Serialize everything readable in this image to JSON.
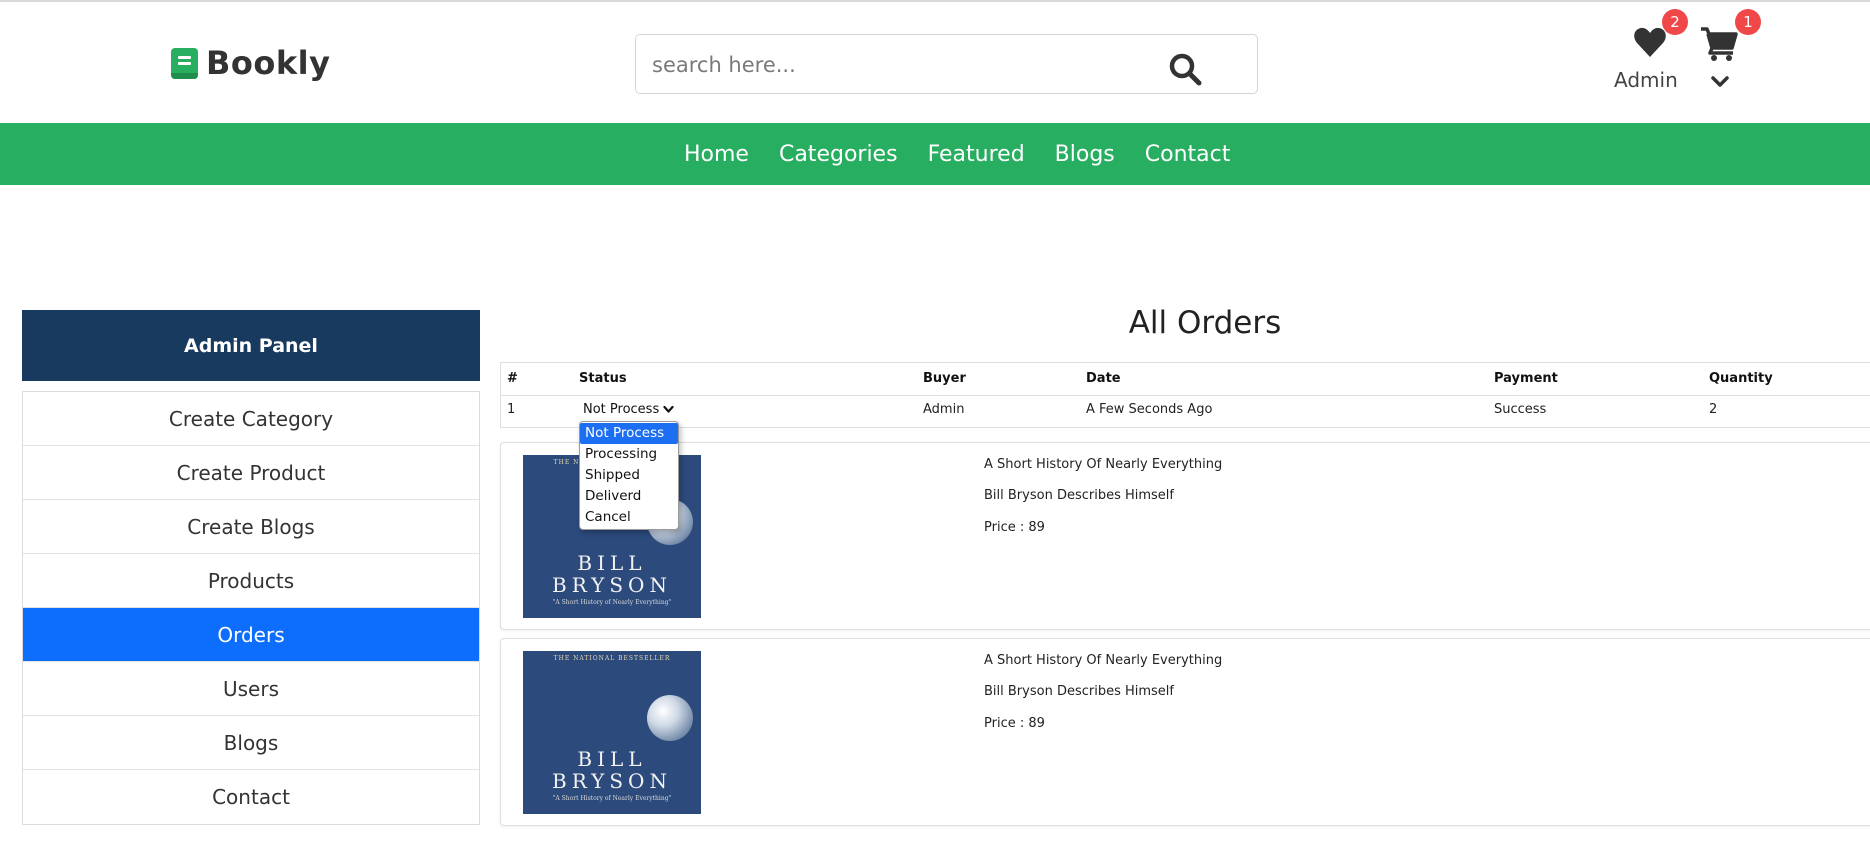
{
  "brand": {
    "name": "Bookly"
  },
  "search": {
    "placeholder": "search here..."
  },
  "header": {
    "wishlist_count": "2",
    "cart_count": "1",
    "user_label": "Admin"
  },
  "nav": {
    "items": [
      {
        "label": "Home"
      },
      {
        "label": "Categories"
      },
      {
        "label": "Featured"
      },
      {
        "label": "Blogs"
      },
      {
        "label": "Contact"
      }
    ]
  },
  "sidebar": {
    "title": "Admin Panel",
    "items": [
      {
        "label": "Create Category"
      },
      {
        "label": "Create Product"
      },
      {
        "label": "Create Blogs"
      },
      {
        "label": "Products"
      },
      {
        "label": "Orders",
        "active": true
      },
      {
        "label": "Users"
      },
      {
        "label": "Blogs"
      },
      {
        "label": "Contact"
      }
    ]
  },
  "main": {
    "title": "All Orders",
    "table": {
      "headers": [
        "#",
        "Status",
        "Buyer",
        "Date",
        "Payment",
        "Quantity"
      ],
      "row": {
        "index": "1",
        "status": "Not Process",
        "buyer": "Admin",
        "date": "A Few Seconds Ago",
        "payment": "Success",
        "quantity": "2"
      }
    },
    "status_options": [
      "Not Process",
      "Processing",
      "Shipped",
      "Deliverd",
      "Cancel"
    ],
    "products": [
      {
        "name": "A Short History Of Nearly Everything",
        "description": "Bill Bryson Describes Himself",
        "price": "Price : 89",
        "cover": {
          "line1": "BILL",
          "line2": "BRYSON",
          "tagline": "THE NATIONAL BESTSELLER",
          "subtitle": "\"A Short History of Nearly Everything\""
        }
      },
      {
        "name": "A Short History Of Nearly Everything",
        "description": "Bill Bryson Describes Himself",
        "price": "Price : 89",
        "cover": {
          "line1": "BILL",
          "line2": "BRYSON",
          "tagline": "THE NATIONAL BESTSELLER",
          "subtitle": "\"A Short History of Nearly Everything\""
        }
      }
    ]
  },
  "colors": {
    "brand_green": "#27ae60",
    "panel_navy": "#173a5e",
    "active_blue": "#0d6efd",
    "badge_red": "#f04848"
  },
  "icons": {
    "search": "search-icon",
    "wishlist": "heart-icon",
    "cart": "cart-icon",
    "user_menu": "chevron-down-icon",
    "logo": "book-icon"
  }
}
